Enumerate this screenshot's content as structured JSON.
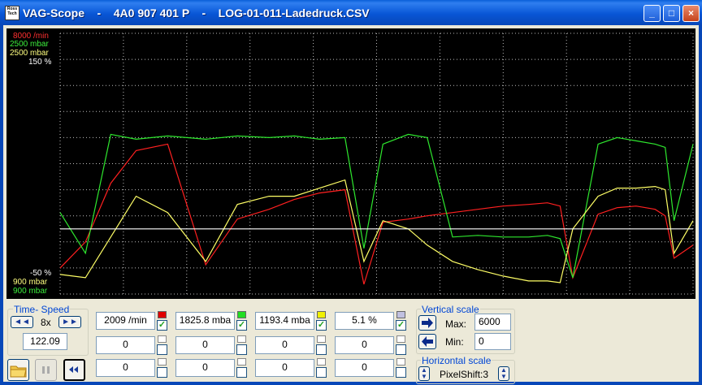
{
  "window": {
    "title": "VAG-Scope    -    4A0 907 401 P    -    LOG-01-011-Ladedruck.CSV",
    "icon_text": "Ross Tech",
    "minimize": "_",
    "maximize": "□",
    "close": "×"
  },
  "scope": {
    "top_labels": [
      "8000 /min",
      "2500 mbar",
      "2500 mbar",
      "150 %"
    ],
    "bottom_labels": [
      "-50 %",
      "900 mbar",
      "900 mbar"
    ],
    "colors": {
      "rpm": "#ff2020",
      "boost_spec": "#2ee82e",
      "boost_actual": "#ffff66",
      "percent": "#ffffff",
      "grid": "#bcbcbc"
    }
  },
  "time_speed": {
    "label": "Time- Speed",
    "rewind_icon": "◄◄",
    "speed": "8x",
    "forward_icon": "►►",
    "time": "122.09"
  },
  "channels": [
    {
      "value": "2009 /min",
      "color": "#e00000",
      "checked": true,
      "row2": "0",
      "row3": "0"
    },
    {
      "value": "1825.8 mba",
      "color": "#22dd22",
      "checked": true,
      "row2": "0",
      "row3": "0"
    },
    {
      "value": "1193.4 mba",
      "color": "#f0f000",
      "checked": true,
      "row2": "0",
      "row3": "0"
    },
    {
      "value": "5.1 %",
      "color": "#c0c0e0",
      "checked": true,
      "row2": "0",
      "row3": "0"
    }
  ],
  "vertical_scale": {
    "label": "Vertical scale",
    "max_label": "Max:",
    "max_value": "6000",
    "min_label": "Min:",
    "min_value": "0"
  },
  "horizontal_scale": {
    "label": "Horizontal scale",
    "pixelshift": "PixelShift:3"
  },
  "controls": {
    "open_icon": "folder-icon",
    "pause_icon": "pause-icon",
    "rewind_icon": "rewind-icon"
  },
  "chart_data": {
    "type": "line",
    "title": "",
    "x": [
      0,
      4,
      8,
      12,
      17,
      23,
      28,
      33,
      37,
      41,
      45,
      48,
      51,
      55,
      58,
      62,
      66,
      70,
      74,
      77,
      79,
      81,
      85,
      88,
      91,
      94,
      95.6,
      97,
      100
    ],
    "series": [
      {
        "name": "8000 /min",
        "axis_min": 0,
        "axis_max": 8000,
        "values": [
          800,
          1600,
          3400,
          4400,
          4600,
          900,
          2300,
          2600,
          2900,
          3100,
          3200,
          300,
          2200,
          2300,
          2400,
          2500,
          2600,
          2700,
          2750,
          2800,
          2700,
          500,
          2450,
          2650,
          2700,
          2600,
          2400,
          1100,
          1500
        ]
      },
      {
        "name": "2500 mbar",
        "axis_min": 900,
        "axis_max": 2500,
        "values": [
          1400,
          1150,
          1880,
          1850,
          1870,
          1850,
          1870,
          1860,
          1870,
          1850,
          1860,
          1180,
          1820,
          1880,
          1860,
          1250,
          1260,
          1250,
          1250,
          1260,
          1240,
          1000,
          1820,
          1860,
          1840,
          1820,
          1800,
          1350,
          1820
        ]
      },
      {
        "name": "2500 mbar",
        "axis_min": 900,
        "axis_max": 2500,
        "values": [
          1020,
          1000,
          1250,
          1500,
          1400,
          1100,
          1450,
          1500,
          1500,
          1550,
          1600,
          1100,
          1350,
          1300,
          1200,
          1100,
          1050,
          1010,
          980,
          980,
          970,
          1300,
          1500,
          1550,
          1550,
          1560,
          1540,
          1150,
          1350
        ]
      },
      {
        "name": "150 %",
        "axis_min": -50,
        "axis_max": 150,
        "values": [
          0,
          0,
          0,
          0,
          0,
          0,
          0,
          0,
          0,
          0,
          0,
          0,
          0,
          0,
          0,
          0,
          0,
          0,
          0,
          0,
          0,
          0,
          0,
          0,
          0,
          0,
          0,
          0,
          0
        ]
      }
    ],
    "xlabel": "",
    "ylabel": "",
    "grid": true
  }
}
